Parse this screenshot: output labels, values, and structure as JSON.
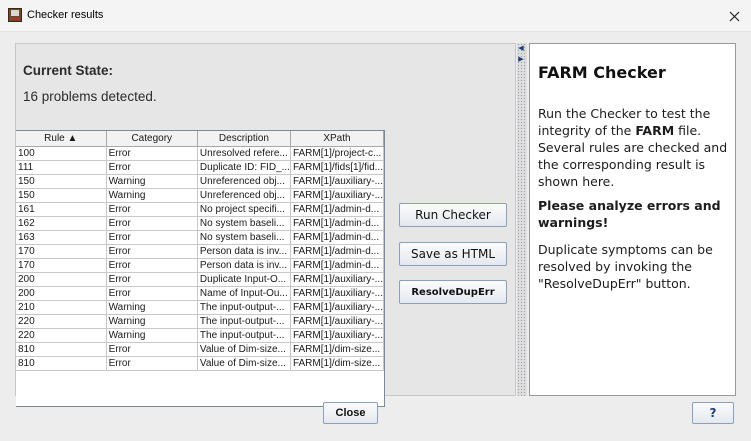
{
  "window": {
    "title": "Checker results"
  },
  "state": {
    "heading": "Current State:",
    "problems": "16 problems detected."
  },
  "table": {
    "columns": [
      "Rule ▲",
      "Category",
      "Description",
      "XPath"
    ],
    "rows": [
      [
        "100",
        "Error",
        "Unresolved refere...",
        "FARM[1]/project-c..."
      ],
      [
        "111",
        "Error",
        "Duplicate ID: FID_...",
        "FARM[1]/fids[1]/fid..."
      ],
      [
        "150",
        "Warning",
        "Unreferenced obj...",
        "FARM[1]/auxiliary-..."
      ],
      [
        "150",
        "Warning",
        "Unreferenced obj...",
        "FARM[1]/auxiliary-..."
      ],
      [
        "161",
        "Error",
        "No project specifi...",
        "FARM[1]/admin-d..."
      ],
      [
        "162",
        "Error",
        "No system baseli...",
        "FARM[1]/admin-d..."
      ],
      [
        "163",
        "Error",
        "No system baseli...",
        "FARM[1]/admin-d..."
      ],
      [
        "170",
        "Error",
        "Person data is inv...",
        "FARM[1]/admin-d..."
      ],
      [
        "170",
        "Error",
        "Person data is inv...",
        "FARM[1]/admin-d..."
      ],
      [
        "200",
        "Error",
        "Duplicate Input-O...",
        "FARM[1]/auxiliary-..."
      ],
      [
        "200",
        "Error",
        "Name of Input-Ou...",
        "FARM[1]/auxiliary-..."
      ],
      [
        "210",
        "Warning",
        "The input-output-...",
        "FARM[1]/auxiliary-..."
      ],
      [
        "220",
        "Warning",
        "The input-output-...",
        "FARM[1]/auxiliary-..."
      ],
      [
        "220",
        "Warning",
        "The input-output-...",
        "FARM[1]/auxiliary-..."
      ],
      [
        "810",
        "Error",
        "Value of Dim-size...",
        "FARM[1]/dim-size..."
      ],
      [
        "810",
        "Error",
        "Value of Dim-size...",
        "FARM[1]/dim-size..."
      ]
    ]
  },
  "buttons": {
    "run": "Run Checker",
    "save": "Save as HTML",
    "resolve": "ResolveDupErr",
    "close": "Close",
    "help": "?"
  },
  "info": {
    "title": "FARM Checker",
    "p1_before": "Run the Checker to test the integrity of the ",
    "p1_bold": "FARM",
    "p1_after": " file. Several rules are checked and the corresponding result is shown here.",
    "p2": "Please analyze errors and warnings!",
    "p3": "Duplicate symptoms can be resolved by invoking the \"ResolveDupErr\" button."
  }
}
